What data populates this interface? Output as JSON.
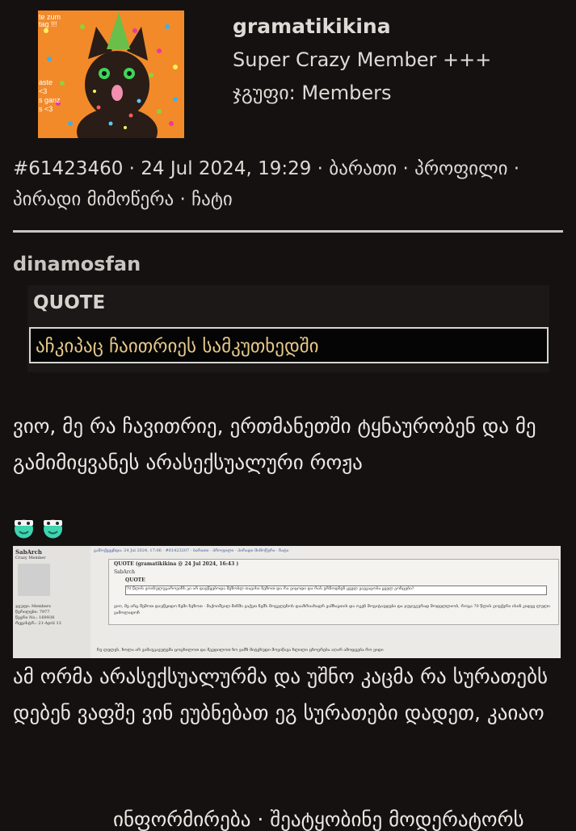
{
  "author": {
    "avatar_icon": "party-cat-avatar",
    "avatar_text": [
      "te zum",
      "tag !!!",
      "aste",
      "<3",
      "s ganz",
      "s <3"
    ],
    "name": "gramatikikina",
    "rank": "Super Crazy Member +++",
    "group": "ჯგუფი: Members"
  },
  "meta": {
    "post_id": "#61423460",
    "sep": " · ",
    "date": "24 Jul 2024, 19:29",
    "card": "ბარათი",
    "profile": "პროფილი",
    "pm": "პირადი მიმოწერა",
    "chat": "ჩატი"
  },
  "quote": {
    "author": "dinamosfan",
    "header": "QUOTE",
    "text": "აჩკიპაც ჩაითრიეს სამკუთხედში"
  },
  "post": {
    "text": "ვიო, მე რა ჩავითრიე, ერთმანეთში ტყნაურობენ და მე გამიმიყვანეს არასექსუალური როჟა",
    "smilies": [
      "nerd-smiley-icon",
      "nerd-smiley-icon"
    ],
    "text2": "ამ ორმა არასექსუალურმა და უშნო კაცმა რა სურათებს დებენ ვაფშე ვინ ეუბნებათ ეგ სურათები დადეთ, კაიაო",
    "signature": "ინფორმირება · შეატყობინე მოდერატორს"
  },
  "embedded_screenshot": {
    "user": "SabArch",
    "rank": "Crazy Member",
    "stats": [
      "ჯგუფი: Members",
      "წერილები: 7977",
      "წევრი No.: 169938",
      "რეგისტრ.: 21-April 13"
    ],
    "bar": "გამოქვეყნდა: 24 Jul 2024, 17:06 · #61423207 · ბარათი · პროფილი · პირადი მიმოწერა · ჩატი",
    "quote_label": "QUOTE (gramatikikina @ 24 Jul 2024, 16:43 )",
    "quote_author": "SabArch",
    "quote_header": "QUOTE",
    "inner_quote": "70 წლის ვოინულუკაროვიჩს კი არ დაეწყებოდა მეზობლ თავისი ნეზოთ და რა ვიცოდი და რას ერჩოდნენ ყველ ვაჟკაცობა ყველ კონცები?",
    "body": "ვიო, მე არც შემოთ დაუწყიდო ჩემი ნეზოთ · მაქოიშვილ მიჩში ვაქვთ ჩემს მოგვლენოს დააზრიახადრ ვამხავთის და ოკენ მოგიტაუდები და ჯუჯუკურად მოდელლიობ, როცა 70 წლის ვიფქერი ისინ კიდევ ლული ვამოლადოჩ",
    "footer": "ჩუ ლელეს, ხოლა არ ვამაუკავუტემა ცოცხილოთ და მკვდილოთ ხო ვამზ მიტეხუდი მოვიწავა ხლილი ცხოვრება აღარ ამოდგება რო ვიდი"
  }
}
